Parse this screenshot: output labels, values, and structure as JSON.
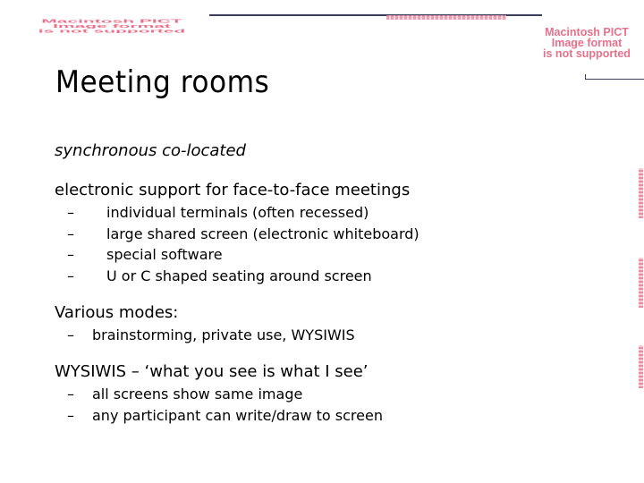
{
  "slide": {
    "title": "Meeting rooms",
    "subtitle": "synchronous co-located",
    "sections": [
      {
        "heading": "electronic support for face-to-face meetings",
        "bullets": [
          "individual terminals (often recessed)",
          "large shared screen (electronic whiteboard)",
          "special software",
          "U or C shaped seating around screen"
        ]
      },
      {
        "heading": "Various modes:",
        "bullets": [
          "brainstorming, private use, WYSIWIS"
        ]
      },
      {
        "heading": "WYSIWIS – ‘what you see is what I see’",
        "bullets": [
          "all screens show same image",
          "any participant can write/draw to screen"
        ]
      }
    ],
    "bullet_glyph": "–"
  },
  "placeholders": {
    "pict_message_line1": "Macintosh PICT",
    "pict_message_line2": "Image format",
    "pict_message_line3": "is not supported",
    "pict_color": "#e8708a"
  },
  "colors": {
    "rule": "#3b3b5a",
    "text": "#000000",
    "background": "#ffffff"
  }
}
